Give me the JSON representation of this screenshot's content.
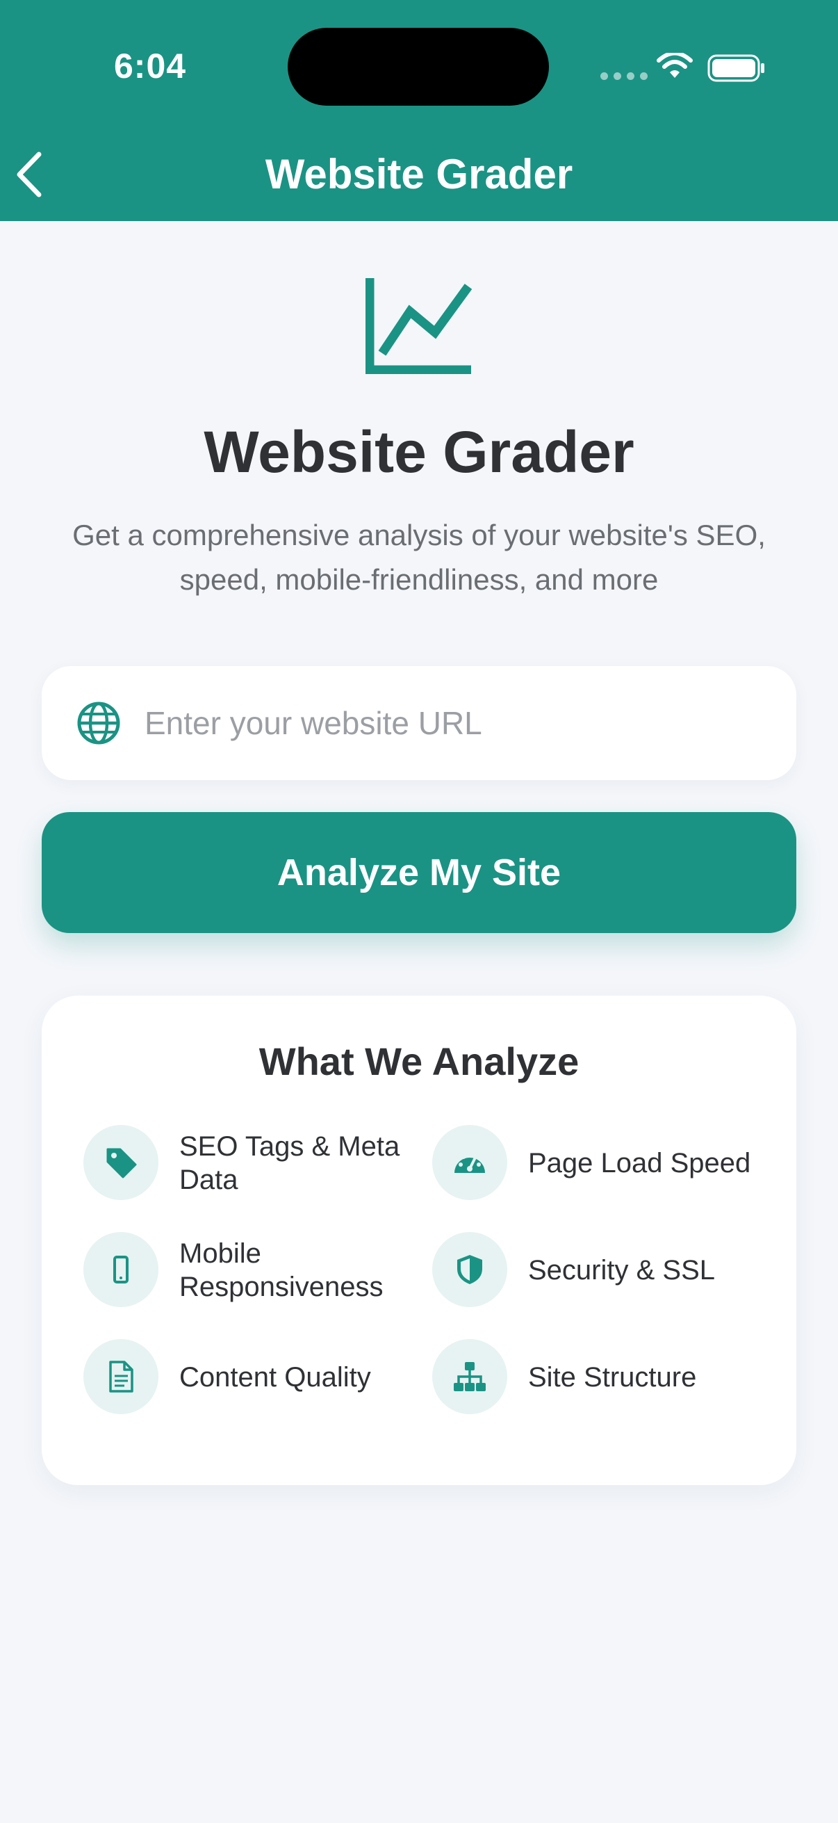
{
  "status_bar": {
    "time": "6:04"
  },
  "nav": {
    "title": "Website Grader",
    "back_icon": "chevron-left-icon"
  },
  "hero": {
    "icon": "line-chart-icon",
    "title": "Website Grader",
    "subtitle": "Get a comprehensive analysis of your website's SEO, speed, mobile-friendliness, and more"
  },
  "url_field": {
    "icon": "globe-icon",
    "value": "",
    "placeholder": "Enter your website URL"
  },
  "analyze_button": {
    "label": "Analyze My Site"
  },
  "analyze_card": {
    "title": "What We Analyze",
    "features": [
      {
        "icon": "tag-icon",
        "label": "SEO Tags & Meta Data"
      },
      {
        "icon": "speedometer-icon",
        "label": "Page Load Speed"
      },
      {
        "icon": "mobile-phone-icon",
        "label": "Mobile Responsiveness"
      },
      {
        "icon": "shield-icon",
        "label": "Security & SSL"
      },
      {
        "icon": "document-icon",
        "label": "Content Quality"
      },
      {
        "icon": "sitemap-icon",
        "label": "Site Structure"
      }
    ]
  },
  "colors": {
    "primary": "#1a9384",
    "background": "#f4f6fa",
    "text": "#2f3135",
    "muted": "#6a6d72",
    "badge": "#e6f3f2"
  }
}
